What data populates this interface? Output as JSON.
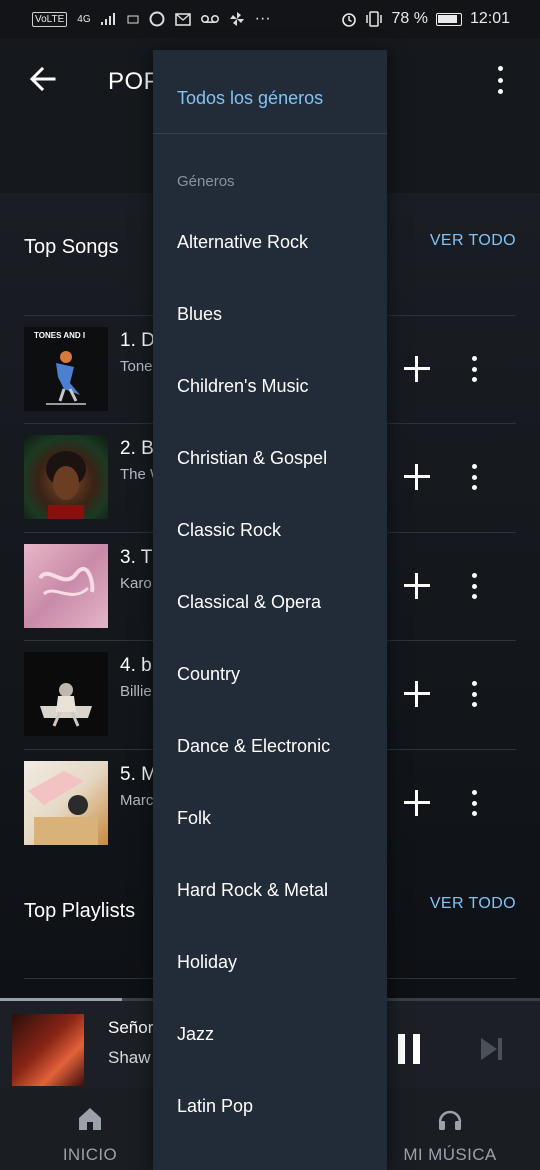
{
  "status_bar": {
    "left_icons": [
      "VoLTE",
      "4G",
      "signal-icon",
      "sim-icon",
      "circle-icon",
      "mail-icon",
      "voicemail-icon",
      "fan-icon",
      "more-dots"
    ],
    "volte": "VoLTE",
    "network": "4G",
    "battery": "78 %",
    "time": "12:01"
  },
  "header": {
    "title": "POP"
  },
  "top_songs": {
    "title": "Top Songs",
    "see_all": "VER TODO",
    "items": [
      {
        "title": "1. D",
        "artist": "Tone",
        "art_text": "TONES AND I"
      },
      {
        "title": "2. B",
        "artist": "The W"
      },
      {
        "title": "3. T",
        "artist": "Karo"
      },
      {
        "title": "4. b",
        "artist": "Billie"
      },
      {
        "title": "5. M",
        "artist": "Marc"
      }
    ]
  },
  "top_playlists": {
    "title": "Top Playlists",
    "see_all": "VER TODO"
  },
  "now_playing": {
    "title": "Señor",
    "artist": "Shaw",
    "progress": 0.226
  },
  "bottom_nav": {
    "home": "INICIO",
    "my_music": "MI MÚSICA"
  },
  "genre_menu": {
    "selected": "Todos los géneros",
    "header": "Géneros",
    "items": [
      "Alternative Rock",
      "Blues",
      "Children's Music",
      "Christian & Gospel",
      "Classic Rock",
      "Classical & Opera",
      "Country",
      "Dance & Electronic",
      "Folk",
      "Hard Rock & Metal",
      "Holiday",
      "Jazz",
      "Latin Pop"
    ]
  },
  "colors": {
    "accent": "#7fc4f5",
    "menu_bg": "#222b38",
    "background": "#0f1216"
  }
}
